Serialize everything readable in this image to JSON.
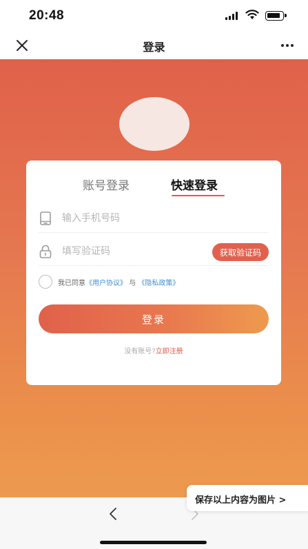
{
  "status_bar": {
    "time": "20:48"
  },
  "nav": {
    "title": "登录",
    "close_icon": "close-icon",
    "more_icon": "more-dots-icon"
  },
  "login_card": {
    "tabs": [
      {
        "label": "账号登录",
        "active": false
      },
      {
        "label": "快速登录",
        "active": true
      }
    ],
    "phone_field": {
      "placeholder": "输入手机号码",
      "value": "",
      "icon": "phone-icon"
    },
    "code_field": {
      "placeholder": "填写验证码",
      "value": "",
      "icon": "lock-icon"
    },
    "get_code_label": "获取验证码",
    "agreement": {
      "prefix": "我已同意",
      "user_agreement": "《用户协议》",
      "conjunction": "与",
      "privacy_policy": "《隐私政策》",
      "checked": false
    },
    "login_button": "登录",
    "register": {
      "prompt": "没有账号?",
      "link": "立即注册"
    }
  },
  "save_image_button": "保存以上内容为图片 >",
  "colors": {
    "accent": "#e05a45",
    "gradient_top": "#e0614a",
    "gradient_bottom": "#ec9a4f",
    "link_blue": "#3f8fd6"
  }
}
